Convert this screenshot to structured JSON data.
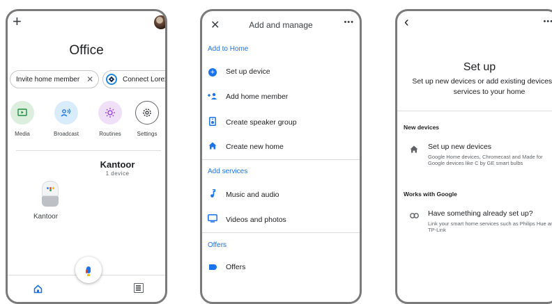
{
  "phone1": {
    "title": "Office",
    "chips": {
      "invite": "Invite home member",
      "connect": "Connect Lorex"
    },
    "actions": [
      {
        "label": "Media"
      },
      {
        "label": "Broadcast"
      },
      {
        "label": "Routines"
      },
      {
        "label": "Settings"
      }
    ],
    "room": {
      "name": "Kantoor",
      "count": "1 device"
    },
    "device": {
      "label": "Kantoor"
    }
  },
  "phone2": {
    "title": "Add and manage",
    "sections": {
      "home": "Add to Home",
      "services": "Add services",
      "offers": "Offers"
    },
    "items": {
      "setup_device": "Set up device",
      "add_member": "Add home member",
      "speaker_group": "Create speaker group",
      "new_home": "Create new home",
      "music": "Music and audio",
      "videos": "Videos and photos",
      "offers": "Offers"
    }
  },
  "phone3": {
    "title": "Set up",
    "subtitle": "Set up new devices or add existing devices and services to your home",
    "new_devices": {
      "section": "New devices",
      "title": "Set up new devices",
      "desc": "Google Home devices, Chromecast and Made for Google devices like C by GE smart bulbs"
    },
    "works_with": {
      "section": "Works with Google",
      "title": "Have something already set up?",
      "desc": "Link your smart home services such as Philips Hue and TP-Link"
    }
  },
  "colors": {
    "accent": "#1a73e8",
    "media": "#1e8e3e",
    "routines": "#9334e6"
  }
}
